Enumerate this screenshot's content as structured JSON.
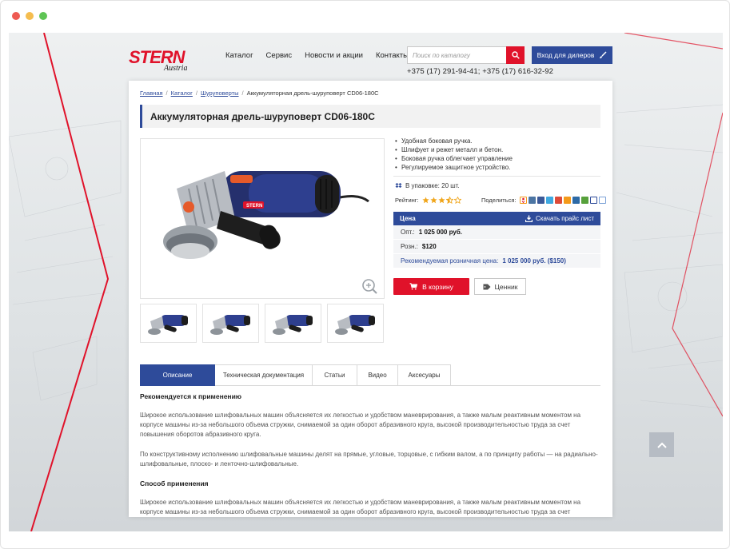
{
  "window": {
    "dots": [
      "#ee5a52",
      "#f5bd4f",
      "#5ec454"
    ]
  },
  "brand": {
    "name": "STERN",
    "sub": "Austria",
    "accent": "#e0122a",
    "primary": "#2e4b9a"
  },
  "nav": [
    "Каталог",
    "Сервис",
    "Новости и акции",
    "Контакты"
  ],
  "search": {
    "placeholder": "Поиск по каталогу",
    "icon": "search-icon"
  },
  "dealer_button": "Вход для дилеров",
  "phones": "+375 (17) 291-94-41;  +375 (17) 616-32-92",
  "breadcrumb": {
    "items": [
      "Главная",
      "Каталог",
      "Шуруповерты"
    ],
    "current": "Аккумуляторная дрель-шуруповерт CD06-180C"
  },
  "product": {
    "title": "Аккумуляторная дрель-шуруповерт CD06-180C",
    "features": [
      "Удобная боковая ручка.",
      "Шлифует и режет металл и бетон.",
      "Боковая ручка облегчает управление",
      "Регулируемое защитное устройство."
    ],
    "pack": "В упаковке: 20 шт.",
    "rating_label": "Рейтинг:",
    "rating_value": 3.5,
    "rating_max": 5,
    "share_label": "Поделиться:",
    "share_icons": [
      "odnoklassniki-icon",
      "vk-icon",
      "facebook-icon",
      "twitter-icon",
      "google-plus-icon",
      "mailru-icon",
      "livejournal-icon",
      "evernote-icon",
      "link-icon",
      "bookmark-icon"
    ],
    "thumbnail_count": 4
  },
  "price": {
    "header": "Цена",
    "download": "Скачать прайс лист",
    "wholesale_label": "Опт.:",
    "wholesale": "1 025 000 руб.",
    "retail_label": "Розн.:",
    "retail": "$120",
    "recommended_label": "Рекомендуемая розничная цена:",
    "recommended": "1 025 000 руб. ($150)"
  },
  "buttons": {
    "cart": "В корзину",
    "tag": "Ценник"
  },
  "tabs": [
    "Описание",
    "Техническая документация",
    "Статьи",
    "Видео",
    "Аксесуары"
  ],
  "description": {
    "h1": "Рекомендуется к применению",
    "p1": "Широкое использование шлифовальных машин объясняется их легкостью и удобством маневрирования, а также малым реактивным моментом на корпусе машины из-за небольшого объема стружки, снимаемой за один оборот абразивного круга, высокой производительностью труда за счет повышения оборотов абразивного круга.",
    "p2": "По конструктивному исполнению шлифовальные машины делят на прямые, угловые, торцовые, с гибким валом, а по принципу работы — на радиально-шлифовальные, плоско- и ленточно-шлифовальные.",
    "h2": "Способ применения",
    "p3": "Широкое использование шлифовальных машин объясняется их легкостью и удобством маневрирования, а также малым реактивным моментом на корпусе машины из-за небольшого объема стружки, снимаемой за один оборот абразивного круга, высокой производительностью труда за счет повышения"
  }
}
